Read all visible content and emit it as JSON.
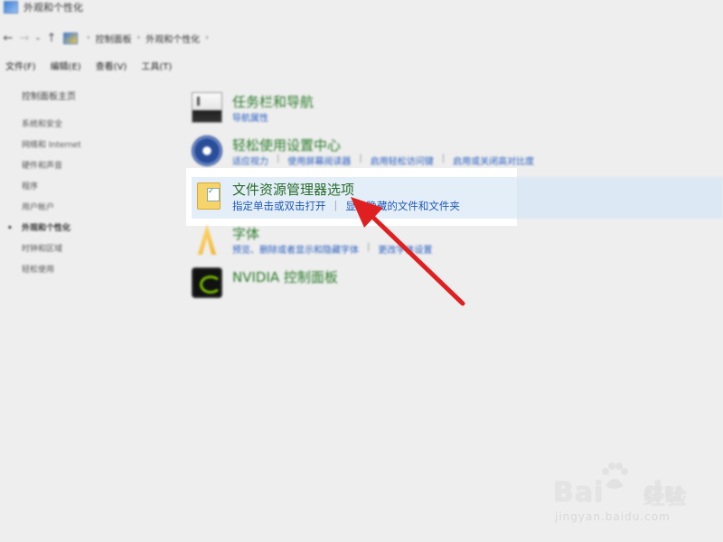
{
  "window": {
    "title": "外观和个性化"
  },
  "address": {
    "back": "←",
    "forward": "→",
    "recent": "⌄",
    "up": "↑",
    "crumbs": [
      "控制面板",
      "外观和个性化"
    ],
    "sep": "›"
  },
  "menu": [
    "文件(F)",
    "编辑(E)",
    "查看(V)",
    "工具(T)"
  ],
  "sidebar": {
    "home": "控制面板主页",
    "items": [
      {
        "label": "系统和安全"
      },
      {
        "label": "网络和 Internet"
      },
      {
        "label": "硬件和声音"
      },
      {
        "label": "程序"
      },
      {
        "label": "用户帐户"
      },
      {
        "label": "外观和个性化",
        "current": true
      },
      {
        "label": "时钟和区域"
      },
      {
        "label": "轻松使用"
      }
    ],
    "bullet": "•"
  },
  "categories": {
    "taskbar": {
      "title": "任务栏和导航",
      "links": [
        "导航属性"
      ]
    },
    "ease": {
      "title": "轻松使用设置中心",
      "links": [
        "适应视力",
        "使用屏幕阅读器",
        "启用轻松访问键",
        "启用或关闭高对比度"
      ]
    },
    "explorer": {
      "title": "文件资源管理器选项",
      "links": [
        "指定单击或双击打开",
        "显示隐藏的文件和文件夹"
      ]
    },
    "fonts": {
      "title": "字体",
      "links": [
        "预览、删除或者显示和隐藏字体",
        "更改字体设置"
      ]
    },
    "nvidia": {
      "title": "NVIDIA 控制面板",
      "links": []
    }
  },
  "annotation": {
    "arrow_color": "#e02020"
  },
  "watermark": {
    "brand": "Bai",
    "brand_suffix": "du",
    "cn": "经验",
    "url": "jingyan.baidu.com"
  }
}
